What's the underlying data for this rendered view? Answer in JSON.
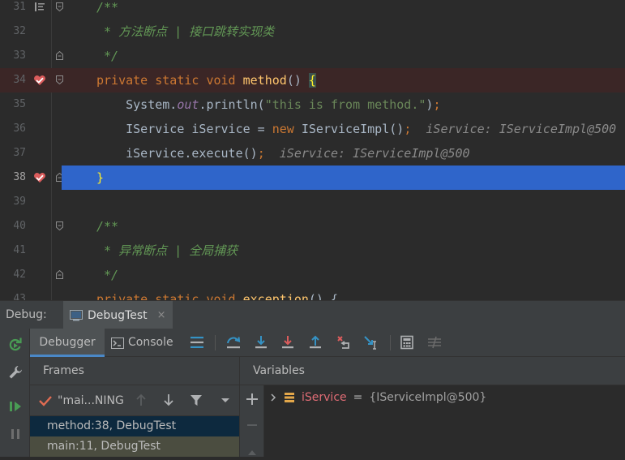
{
  "editor": {
    "lines": [
      {
        "num": "31",
        "segments": [
          {
            "cls": "cm",
            "text": "/**"
          }
        ]
      },
      {
        "num": "32",
        "segments": [
          {
            "cls": "cm",
            "text": " * 方法断点 | 接口跳转实现类"
          }
        ]
      },
      {
        "num": "33",
        "segments": [
          {
            "cls": "cm",
            "text": " */"
          }
        ]
      },
      {
        "num": "34",
        "segments": [
          {
            "cls": "kw",
            "text": "private static void "
          },
          {
            "cls": "fn",
            "text": "method"
          },
          {
            "cls": "",
            "text": "() "
          },
          {
            "cls": "brace-hl",
            "text": "{"
          }
        ]
      },
      {
        "num": "35",
        "segments": [
          {
            "cls": "",
            "text": "    System."
          },
          {
            "cls": "fld",
            "text": "out"
          },
          {
            "cls": "",
            "text": ".println("
          },
          {
            "cls": "st",
            "text": "\"this is from method.\""
          },
          {
            "cls": "",
            "text": ")"
          },
          {
            "cls": "kw",
            "text": ";"
          }
        ]
      },
      {
        "num": "36",
        "segments": [
          {
            "cls": "",
            "text": "    IService iService = "
          },
          {
            "cls": "kw",
            "text": "new "
          },
          {
            "cls": "",
            "text": "IServiceImpl()"
          },
          {
            "cls": "kw",
            "text": ";"
          },
          {
            "cls": "hint",
            "text": "  iService: IServiceImpl@500"
          }
        ]
      },
      {
        "num": "37",
        "segments": [
          {
            "cls": "",
            "text": "    iService.execute()"
          },
          {
            "cls": "kw",
            "text": ";"
          },
          {
            "cls": "hint",
            "text": "  iService: IServiceImpl@500"
          }
        ]
      },
      {
        "num": "38",
        "segments": [
          {
            "cls": "brace",
            "text": "}"
          }
        ]
      },
      {
        "num": "39",
        "segments": []
      },
      {
        "num": "40",
        "segments": [
          {
            "cls": "cm",
            "text": "/**"
          }
        ]
      },
      {
        "num": "41",
        "segments": [
          {
            "cls": "cm",
            "text": " * 异常断点 | 全局捕获"
          }
        ]
      },
      {
        "num": "42",
        "segments": [
          {
            "cls": "cm",
            "text": " */"
          }
        ]
      },
      {
        "num": "43",
        "segments": [
          {
            "cls": "kw",
            "text": "private static void "
          },
          {
            "cls": "fn",
            "text": "exception"
          },
          {
            "cls": "",
            "text": "() {"
          }
        ]
      }
    ]
  },
  "debug": {
    "label": "Debug:",
    "tab_label": "DebugTest",
    "close_glyph": "×"
  },
  "toolbar": {
    "debugger_tab": "Debugger",
    "console_tab": "Console"
  },
  "frames": {
    "title": "Frames",
    "thread": "\"mai...NING",
    "items": [
      "method:38, DebugTest",
      "main:11, DebugTest"
    ]
  },
  "variables": {
    "title": "Variables",
    "items": [
      {
        "name": "iService",
        "eq": "=",
        "value": "{IServiceImpl@500}"
      }
    ]
  },
  "colors": {
    "breakpoint": "#db5c5c",
    "current_line": "#2f65ca",
    "accent": "#4a88c7",
    "resume": "#499c54"
  }
}
